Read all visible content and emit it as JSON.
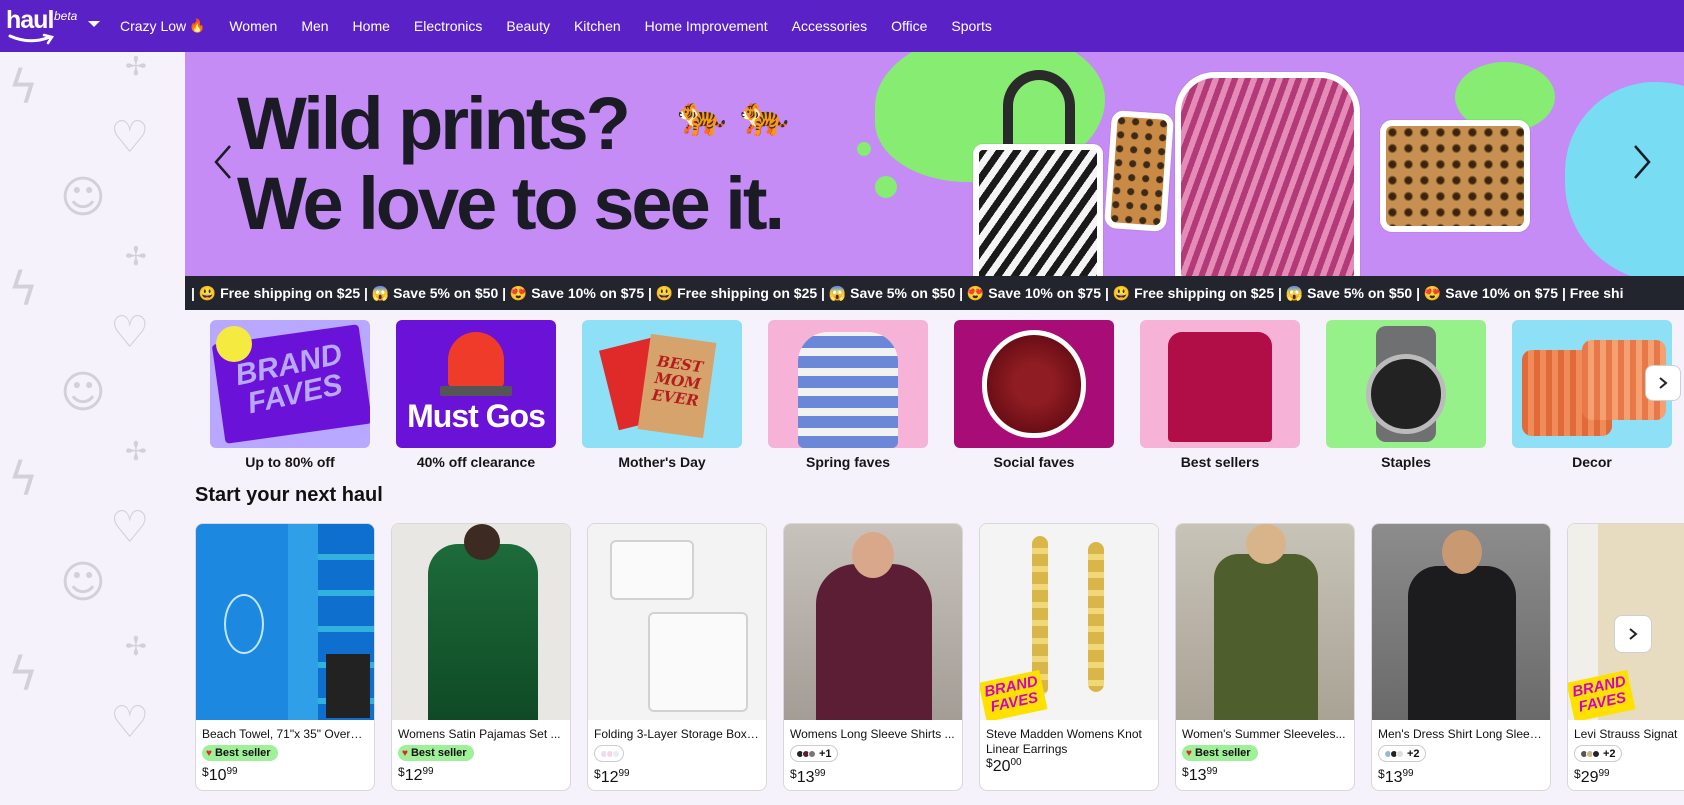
{
  "nav": {
    "logo_word": "haul",
    "logo_beta": "beta",
    "links": [
      "Crazy Low",
      "Women",
      "Men",
      "Home",
      "Electronics",
      "Beauty",
      "Kitchen",
      "Home Improvement",
      "Accessories",
      "Office",
      "Sports"
    ],
    "crazy_low_icon": "🔥"
  },
  "hero": {
    "line1": "Wild prints?",
    "line2": "We love to see it.",
    "emoji": "🐅 🐅"
  },
  "ticker": {
    "text": "| 😃 Free shipping on $25 | 😱 Save 5% on $50 | 😍 Save 10% on $75 | 😃 Free shipping on $25 | 😱 Save 5% on $50 | 😍 Save 10% on $75 | 😃 Free shipping on $25 | 😱 Save 5% on $50 | 😍 Save 10% on $75 | Free shi"
  },
  "categories": [
    {
      "label": "Up to 80% off",
      "tile_text": "BRAND FAVES",
      "color": "#b8a8ff"
    },
    {
      "label": "40% off clearance",
      "tile_text": "Must Gos",
      "color": "#6a12d8"
    },
    {
      "label": "Mother's Day",
      "tile_text": "BEST MOM EVER",
      "color": "#8ee0f6"
    },
    {
      "label": "Spring faves",
      "tile_text": "",
      "color": "#f7b2d8"
    },
    {
      "label": "Social faves",
      "tile_text": "",
      "color": "#a80c77"
    },
    {
      "label": "Best sellers",
      "tile_text": "",
      "color": "#f7b2d8"
    },
    {
      "label": "Staples",
      "tile_text": "",
      "color": "#97f18a"
    },
    {
      "label": "Decor",
      "tile_text": "",
      "color": "#8ee0f6"
    }
  ],
  "section_title": "Start your next haul",
  "products": [
    {
      "title": "Beach Towel, 71\"x 35\" Oversi...",
      "badge": "Best seller",
      "price_whole": "10",
      "price_frac": "99"
    },
    {
      "title": "Womens Satin Pajamas Set ...",
      "badge": "Best seller",
      "price_whole": "12",
      "price_frac": "99"
    },
    {
      "title": "Folding 3-Layer Storage Box ...",
      "swatch": "",
      "price_whole": "12",
      "price_frac": "99"
    },
    {
      "title": "Womens Long Sleeve Shirts ...",
      "swatch": "+1",
      "price_whole": "13",
      "price_frac": "99"
    },
    {
      "title": "Steve Madden Womens Knot Linear Earrings",
      "brand": "BRAND FAVES",
      "price_whole": "20",
      "price_frac": "00"
    },
    {
      "title": "Women's Summer Sleeveles...",
      "badge": "Best seller",
      "price_whole": "13",
      "price_frac": "99"
    },
    {
      "title": "Men's Dress Shirt Long Sleev...",
      "swatch": "+2",
      "price_whole": "13",
      "price_frac": "99"
    },
    {
      "title": "Levi Strauss Signat",
      "brand": "BRAND FAVES",
      "swatch": "+2",
      "price_whole": "29",
      "price_frac": "99"
    }
  ],
  "currency": "$",
  "colors": {
    "nav": "#5a22c6",
    "hero": "#c58cf5",
    "ticker": "#22252d",
    "badge": "#9ff098"
  },
  "icons": {
    "prev": "chevron-left-icon",
    "next": "chevron-right-icon",
    "menu": "caret-down-icon"
  }
}
